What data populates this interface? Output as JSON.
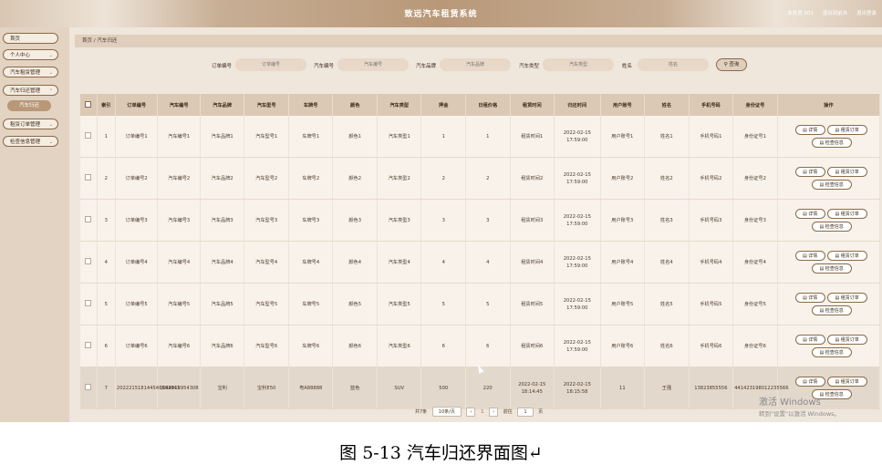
{
  "header": {
    "title": "致远汽车租赁系统",
    "user": "业务员 001",
    "back_front": "退出到前台",
    "logout": "退出登录"
  },
  "sidebar": {
    "items": [
      {
        "label": "首页"
      },
      {
        "label": "个人中心"
      },
      {
        "label": "汽车租赁管理"
      },
      {
        "label": "汽车归还管理"
      },
      {
        "label": "汽车归还"
      },
      {
        "label": "租赁订单管理"
      },
      {
        "label": "检查信息管理"
      }
    ]
  },
  "breadcrumb": {
    "home": "首页",
    "sep": "/",
    "current": "汽车归还"
  },
  "search": {
    "fields": [
      {
        "label": "订单编号",
        "placeholder": "订单编号"
      },
      {
        "label": "汽车编号",
        "placeholder": "汽车编号"
      },
      {
        "label": "汽车品牌",
        "placeholder": "汽车品牌"
      },
      {
        "label": "汽车类型",
        "placeholder": "汽车类型"
      },
      {
        "label": "姓名",
        "placeholder": "姓名"
      }
    ],
    "button": "查询"
  },
  "table": {
    "headers": [
      "索引",
      "订单编号",
      "汽车编号",
      "汽车品牌",
      "汽车型号",
      "车牌号",
      "颜色",
      "汽车类型",
      "押金",
      "日租价格",
      "租赁时间",
      "归还时间",
      "用户账号",
      "姓名",
      "手机号码",
      "身份证号",
      "操作"
    ],
    "rows": [
      [
        "1",
        "订单编号1",
        "汽车编号1",
        "汽车品牌1",
        "汽车型号1",
        "车牌号1",
        "颜色1",
        "汽车类型1",
        "1",
        "1",
        "租赁时间1",
        "2022-02-15 17:59:00",
        "用户账号1",
        "姓名1",
        "手机号码1",
        "身份证号1"
      ],
      [
        "2",
        "订单编号2",
        "汽车编号2",
        "汽车品牌2",
        "汽车型号2",
        "车牌号2",
        "颜色2",
        "汽车类型2",
        "2",
        "2",
        "租赁时间2",
        "2022-02-15 17:59:00",
        "用户账号2",
        "姓名2",
        "手机号码2",
        "身份证号2"
      ],
      [
        "3",
        "订单编号3",
        "汽车编号3",
        "汽车品牌3",
        "汽车型号3",
        "车牌号3",
        "颜色3",
        "汽车类型3",
        "3",
        "3",
        "租赁时间3",
        "2022-02-15 17:59:00",
        "用户账号3",
        "姓名3",
        "手机号码3",
        "身份证号3"
      ],
      [
        "4",
        "订单编号4",
        "汽车编号4",
        "汽车品牌4",
        "汽车型号4",
        "车牌号4",
        "颜色4",
        "汽车类型4",
        "4",
        "4",
        "租赁时间4",
        "2022-02-15 17:59:00",
        "用户账号4",
        "姓名4",
        "手机号码4",
        "身份证号4"
      ],
      [
        "5",
        "订单编号5",
        "汽车编号5",
        "汽车品牌5",
        "汽车型号5",
        "车牌号5",
        "颜色5",
        "汽车类型5",
        "5",
        "5",
        "租赁时间5",
        "2022-02-15 17:59:00",
        "用户账号5",
        "姓名5",
        "手机号码5",
        "身份证号5"
      ],
      [
        "6",
        "订单编号6",
        "汽车编号6",
        "汽车品牌6",
        "汽车型号6",
        "车牌号6",
        "颜色6",
        "汽车类型6",
        "6",
        "6",
        "租赁时间6",
        "2022-02-15 17:59:00",
        "用户账号6",
        "姓名6",
        "手机号码6",
        "身份证号6"
      ],
      [
        "7",
        "202221518144540592841",
        "1644919954308",
        "宝利",
        "宝利E50",
        "粤A88888",
        "蓝色",
        "SUV",
        "500",
        "220",
        "2022-02-15 18:14:45",
        "2022-02-15 18:15:58",
        "11",
        "王强",
        "13823855556",
        "441423198012235566"
      ]
    ],
    "actions": {
      "detail": "详情",
      "order": "租赁订单",
      "check": "检查信息"
    }
  },
  "pager": {
    "total": "共7条",
    "per_page": "10条/页",
    "prev": "‹",
    "page": "1",
    "next": "›",
    "goto": "前往",
    "goto_value": "1",
    "page_unit": "页"
  },
  "watermark": {
    "line1": "激活 Windows",
    "line2": "转到\"设置\"以激活 Windows。"
  },
  "caption": "图 5-13 汽车归还界面图↵",
  "colors": {
    "accent": "#b89878",
    "border": "#8a6a48",
    "bg": "#efe6dc"
  }
}
